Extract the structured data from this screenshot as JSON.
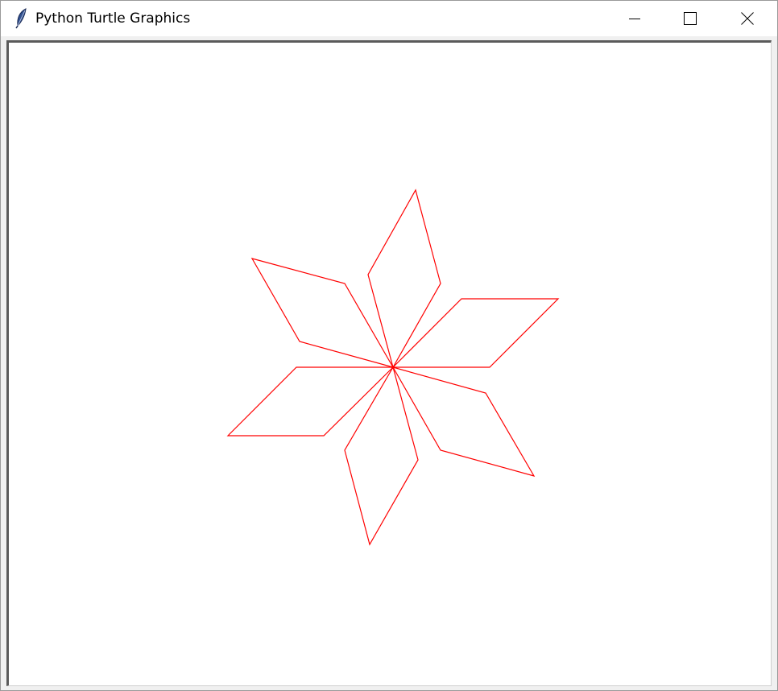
{
  "window": {
    "title": "Python Turtle Graphics",
    "icon": "feather-icon",
    "controls": [
      "minimize-icon",
      "maximize-icon",
      "close-icon"
    ]
  },
  "canvas": {
    "background": "#ffffff",
    "pen_color": "#ff0000",
    "shape": "six-rhombus star (flower)"
  }
}
